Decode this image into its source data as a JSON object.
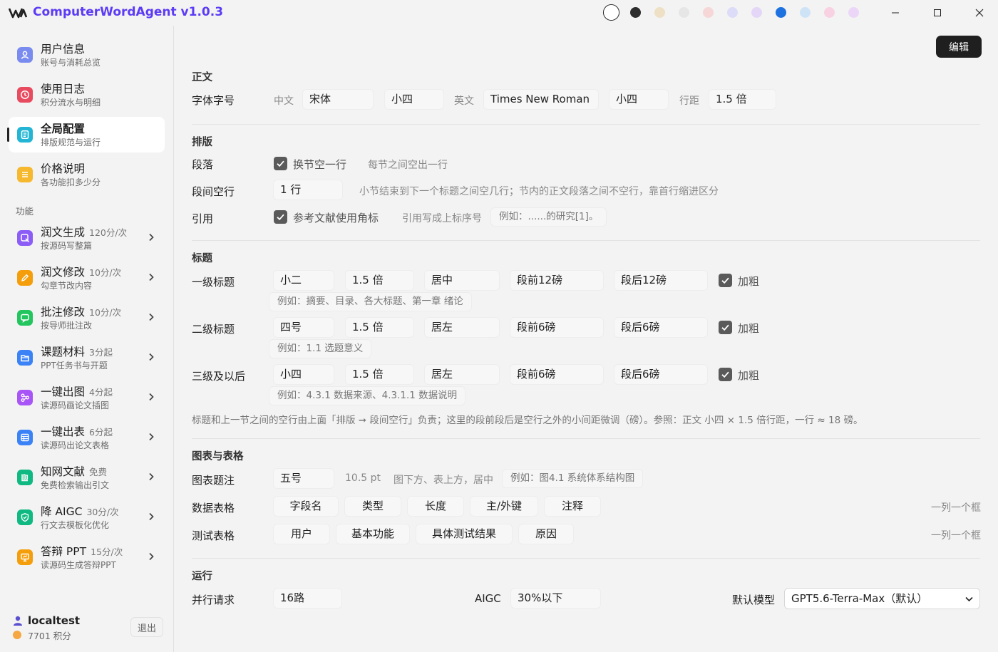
{
  "app": {
    "title": "ComputerWordAgent v1.0.3"
  },
  "theme": {
    "accent": "#5b3bf5",
    "swatches": [
      "#ffffff",
      "#2d2d2d",
      "#ede0c4",
      "#e6e6e6",
      "#f6d6d6",
      "#dcdcf8",
      "#e4d6f6",
      "#1e72e0",
      "#cfe3f7",
      "#f8d2e2",
      "#ecd6f7"
    ],
    "selected_index": 0
  },
  "sidebar": {
    "top_items": [
      {
        "title": "用户信息",
        "sub": "账号与消耗总览",
        "icon": "user-icon",
        "color": "#7a8bf0"
      },
      {
        "title": "使用日志",
        "sub": "积分流水与明细",
        "icon": "clock-icon",
        "color": "#e84a5f"
      },
      {
        "title": "全局配置",
        "sub": "排版规范与运行",
        "icon": "doc-icon",
        "color": "#23b5d3",
        "active": true
      },
      {
        "title": "价格说明",
        "sub": "各功能扣多少分",
        "icon": "list-icon",
        "color": "#f5b82e"
      }
    ],
    "section_label": "功能",
    "feature_items": [
      {
        "title": "润文生成",
        "price": "120分/次",
        "sub": "按源码写整篇",
        "icon": "compose-icon",
        "color": "#8b5cf6"
      },
      {
        "title": "润文修改",
        "price": "10分/次",
        "sub": "勾章节改内容",
        "icon": "pencil-icon",
        "color": "#f59e0b"
      },
      {
        "title": "批注修改",
        "price": "10分/次",
        "sub": "按导师批注改",
        "icon": "comment-icon",
        "color": "#22c55e"
      },
      {
        "title": "课题材料",
        "price": "3分起",
        "sub": "PPT任务书与开题",
        "icon": "folder-icon",
        "color": "#3b82f6"
      },
      {
        "title": "一键出图",
        "price": "4分起",
        "sub": "读源码画论文插图",
        "icon": "diagram-icon",
        "color": "#a855f7"
      },
      {
        "title": "一键出表",
        "price": "6分起",
        "sub": "读源码出论文表格",
        "icon": "table-icon",
        "color": "#3b82f6"
      },
      {
        "title": "知网文献",
        "price": "免费",
        "sub": "免费检索输出引文",
        "icon": "library-icon",
        "color": "#10b981"
      },
      {
        "title": "降 AIGC",
        "price": "30分/次",
        "sub": "行文去模板化优化",
        "icon": "shield-icon",
        "color": "#10b981"
      },
      {
        "title": "答辩 PPT",
        "price": "15分/次",
        "sub": "读源码生成答辩PPT",
        "icon": "presentation-icon",
        "color": "#f59e0b"
      }
    ],
    "user": {
      "name": "localtest",
      "points": "7701 积分",
      "logout_label": "退出"
    }
  },
  "main": {
    "edit_label": "编辑",
    "body": {
      "section": "正文",
      "font_label": "字体字号",
      "zh_label": "中文",
      "zh_font": "宋体",
      "zh_size": "小四",
      "en_label": "英文",
      "en_font": "Times New Roman",
      "en_size": "小四",
      "spacing_label": "行距",
      "spacing": "1.5 倍"
    },
    "layout": {
      "section": "排版",
      "para_label": "段落",
      "para_check": "换节空一行",
      "para_hint": "每节之间空出一行",
      "gap_label": "段间空行",
      "gap_value": "1 行",
      "gap_hint": "小节结束到下一个标题之间空几行；节内的正文段落之间不空行，靠首行缩进区分",
      "cite_label": "引用",
      "cite_check": "参考文献使用角标",
      "cite_hint": "引用写成上标序号",
      "cite_example": "例如：......的研究[1]。"
    },
    "headings": {
      "section": "标题",
      "rows": [
        {
          "label": "一级标题",
          "size": "小二",
          "spacing": "1.5 倍",
          "align": "居中",
          "before": "段前12磅",
          "after": "段后12磅",
          "bold": "加粗",
          "example": "例如：摘要、目录、各大标题、第一章 绪论"
        },
        {
          "label": "二级标题",
          "size": "四号",
          "spacing": "1.5 倍",
          "align": "居左",
          "before": "段前6磅",
          "after": "段后6磅",
          "bold": "加粗",
          "example": "例如：1.1 选题意义"
        },
        {
          "label": "三级及以后",
          "size": "小四",
          "spacing": "1.5 倍",
          "align": "居左",
          "before": "段前6磅",
          "after": "段后6磅",
          "bold": "加粗",
          "example": "例如：4.3.1 数据来源、4.3.1.1 数据说明"
        }
      ],
      "note": "标题和上一节之间的空行由上面「排版 ➞ 段间空行」负责；这里的段前段后是空行之外的小间距微调（磅）。参照：正文 小四 × 1.5 倍行距，一行 ≈ 18 磅。"
    },
    "figures": {
      "section": "图表与表格",
      "caption_label": "图表题注",
      "caption_size": "五号",
      "caption_pt": "10.5 pt",
      "caption_pos": "图下方、表上方，居中",
      "caption_example": "例如：图4.1 系统体系结构图",
      "data_label": "数据表格",
      "data_cols": [
        "字段名",
        "类型",
        "长度",
        "主/外键",
        "注释"
      ],
      "data_hint": "一列一个框",
      "test_label": "测试表格",
      "test_cols": [
        "用户",
        "基本功能",
        "具体测试结果",
        "原因"
      ],
      "test_hint": "一列一个框"
    },
    "run": {
      "section": "运行",
      "parallel_label": "并行请求",
      "parallel_value": "16路",
      "aigc_label": "AIGC",
      "aigc_value": "30%以下",
      "model_label": "默认模型",
      "model_value": "GPT5.6-Terra-Max（默认）"
    }
  }
}
